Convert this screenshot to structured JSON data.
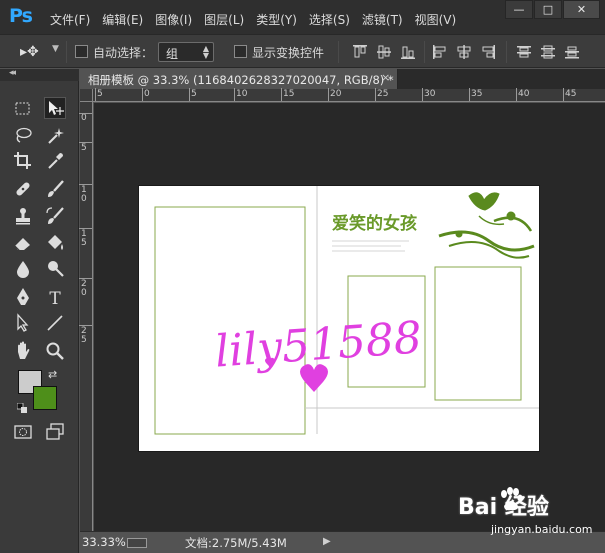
{
  "app": {
    "logo": "Ps"
  },
  "menu": [
    "文件(F)",
    "编辑(E)",
    "图像(I)",
    "图层(L)",
    "类型(Y)",
    "选择(S)",
    "滤镜(T)",
    "视图(V)"
  ],
  "window_controls": {
    "minimize": "—",
    "maximize": "□",
    "close": "✕"
  },
  "options": {
    "auto_select_label": "自动选择：",
    "auto_select_value": "组",
    "show_transform_label": "显示变换控件"
  },
  "document": {
    "tab_title": "相册模板 @ 33.3% (1168402628327020047, RGB/8) *",
    "close": "×"
  },
  "ruler_h_labels": [
    "5",
    "0",
    "5",
    "10",
    "15",
    "20",
    "25",
    "30",
    "35",
    "40",
    "45"
  ],
  "ruler_v_labels": [
    "0",
    "5",
    "1 0",
    "1 5",
    "2 0",
    "2 5"
  ],
  "canvas_art": {
    "heading": "爱笑的女孩",
    "watermark_text": "lily51588",
    "accent_green": "#6a9a2a",
    "watermark_color": "#e040e0"
  },
  "status": {
    "zoom": "33.33%",
    "doc_size": "文档:2.75M/5.43M",
    "arrow": "▶"
  },
  "colors": {
    "foreground": "#cccccc",
    "background": "#4e8f1a"
  },
  "watermark": {
    "logo": "Bai  经验",
    "sub": "jingyan.baidu.com"
  }
}
